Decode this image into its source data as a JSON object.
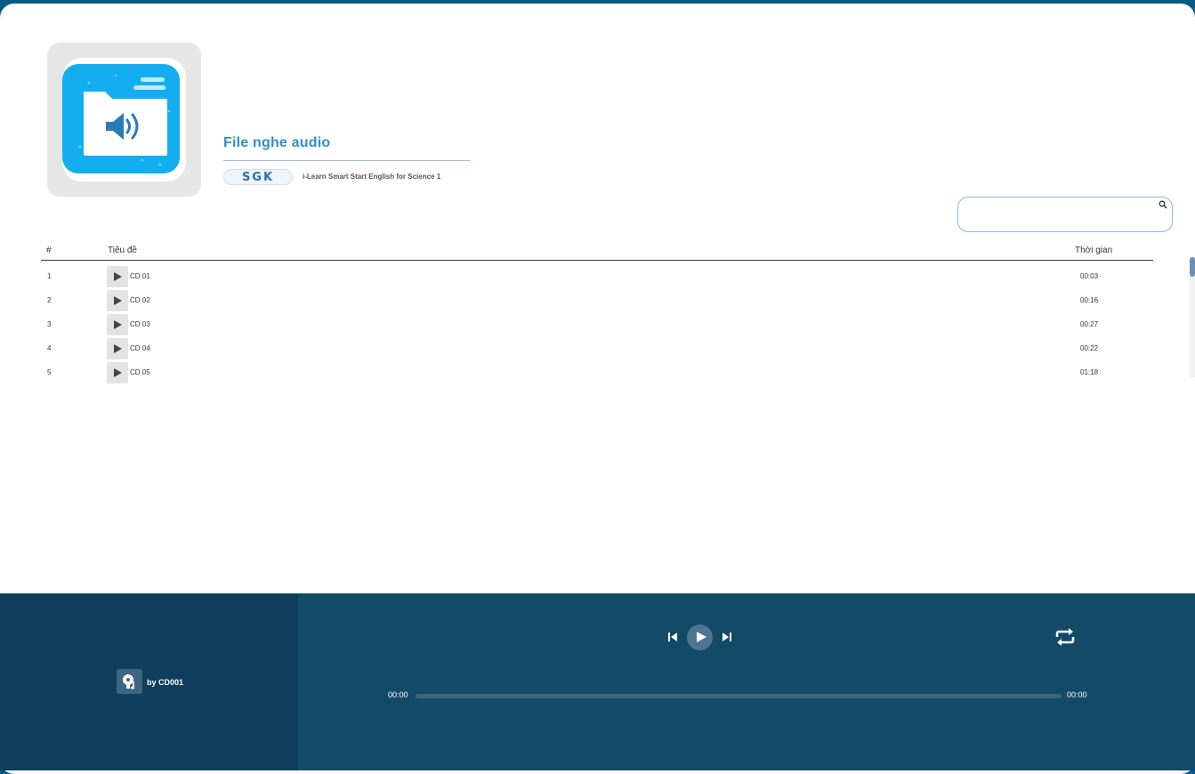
{
  "header": {
    "title": "File nghe audio",
    "publisher_logo_text": "SGK",
    "book_name": "i-Learn Smart Start English for Science 1"
  },
  "search": {
    "placeholder": "",
    "value": ""
  },
  "table": {
    "columns": {
      "num": "#",
      "title": "Tiêu đề",
      "time": "Thời gian"
    },
    "rows": [
      {
        "num": "1",
        "name": "CD 01",
        "duration": "00:03"
      },
      {
        "num": "2",
        "name": "CD 02",
        "duration": "00:16"
      },
      {
        "num": "3",
        "name": "CD 03",
        "duration": "00:27"
      },
      {
        "num": "4",
        "name": "CD 04",
        "duration": "00:22"
      },
      {
        "num": "5",
        "name": "CD 05",
        "duration": "01:18"
      }
    ]
  },
  "player": {
    "artist": "by CD001",
    "current_time": "00:00",
    "total_time": "00:00",
    "progress": 0
  },
  "colors": {
    "accent": "#2f8fc8",
    "player_left": "#0f3f5c",
    "player_right": "#134a68",
    "cover_blue": "#14aef0"
  }
}
